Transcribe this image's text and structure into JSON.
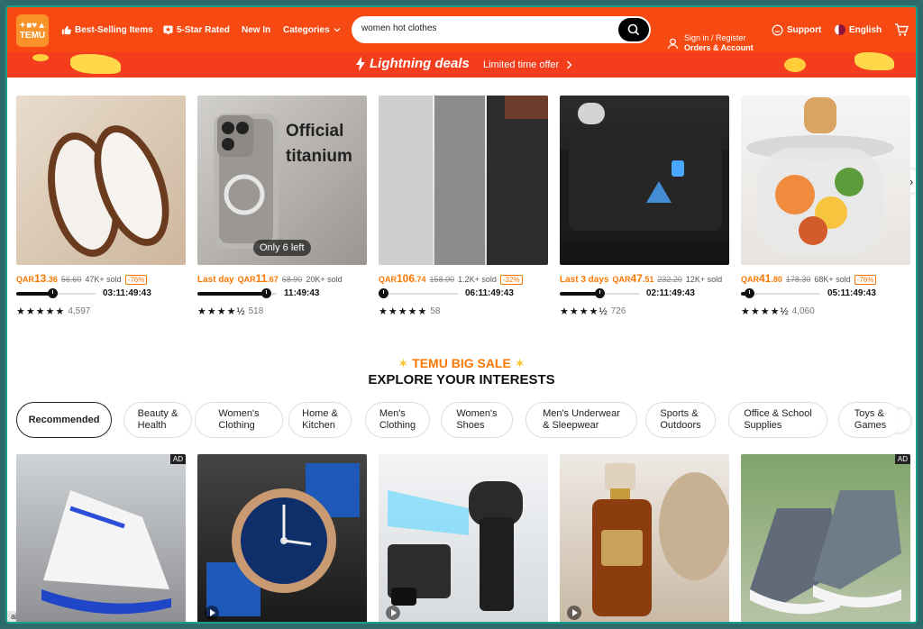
{
  "header": {
    "logo_line1": "✦■♥▲",
    "logo_line2": "TEMU",
    "nav": {
      "best_selling": "Best-Selling Items",
      "five_star": "5-Star Rated",
      "new_in": "New In",
      "categories": "Categories"
    },
    "search": {
      "value": "women hot clothes"
    },
    "account": {
      "line1": "Sign in / Register",
      "line2": "Orders & Account"
    },
    "support": "Support",
    "language": "English"
  },
  "deals_banner": {
    "title": "Lightning deals",
    "offer": "Limited time offer"
  },
  "lightning_products": [
    {
      "prefix": "",
      "currency": "QAR",
      "price_int": "13",
      "price_dec": ".36",
      "orig": "56.60",
      "sold": "47K+ sold",
      "discount": "-76%",
      "progress": 0.45,
      "timer": "03:11:49:43",
      "stars": "★★★★★",
      "reviews": "4,597"
    },
    {
      "prefix": "Last day",
      "currency": "QAR",
      "price_int": "11",
      "price_dec": ".67",
      "orig": "68.90",
      "sold": "20K+ sold",
      "discount": "",
      "progress": 0.86,
      "timer": "11:49:43",
      "stars": "★★★★½",
      "reviews": "518",
      "badge": "Only 6 left",
      "overlay_title": "Official\ntitanium"
    },
    {
      "prefix": "",
      "currency": "QAR",
      "price_int": "106",
      "price_dec": ".74",
      "orig": "158.00",
      "sold": "1.2K+ sold",
      "discount": "-32%",
      "progress": 0.05,
      "timer": "06:11:49:43",
      "stars": "★★★★★",
      "reviews": "58"
    },
    {
      "prefix": "Last 3 days",
      "currency": "QAR",
      "price_int": "47",
      "price_dec": ".51",
      "orig": "232.20",
      "sold": "12K+ sold",
      "discount": "",
      "progress": 0.5,
      "timer": "02:11:49:43",
      "stars": "★★★★½",
      "reviews": "726"
    },
    {
      "prefix": "",
      "currency": "QAR",
      "price_int": "41",
      "price_dec": ".80",
      "orig": "178.30",
      "sold": "68K+ sold",
      "discount": "-76%",
      "progress": 0.1,
      "timer": "05:11:49:43",
      "stars": "★★★★½",
      "reviews": "4,060"
    }
  ],
  "sale_title": "TEMU BIG SALE",
  "explore_title": "EXPLORE YOUR INTERESTS",
  "categories": [
    "Recommended",
    "Beauty &\nHealth",
    "Women's\nClothing",
    "Home &\nKitchen",
    "Men's\nClothing",
    "Women's\nShoes",
    "Men's Underwear\n& Sleepwear",
    "Sports &\nOutdoors",
    "Office & School\nSupplies",
    "Toys &\nGames"
  ],
  "grid_products": [
    {
      "ad": "AD"
    },
    {
      "ad": ""
    },
    {
      "ad": ""
    },
    {
      "ad": ""
    },
    {
      "ad": "AD"
    }
  ],
  "status_url": "als.html",
  "colors": {
    "brand": "#f74a13",
    "accent": "#fb7701",
    "banner": "#f33d1c"
  }
}
